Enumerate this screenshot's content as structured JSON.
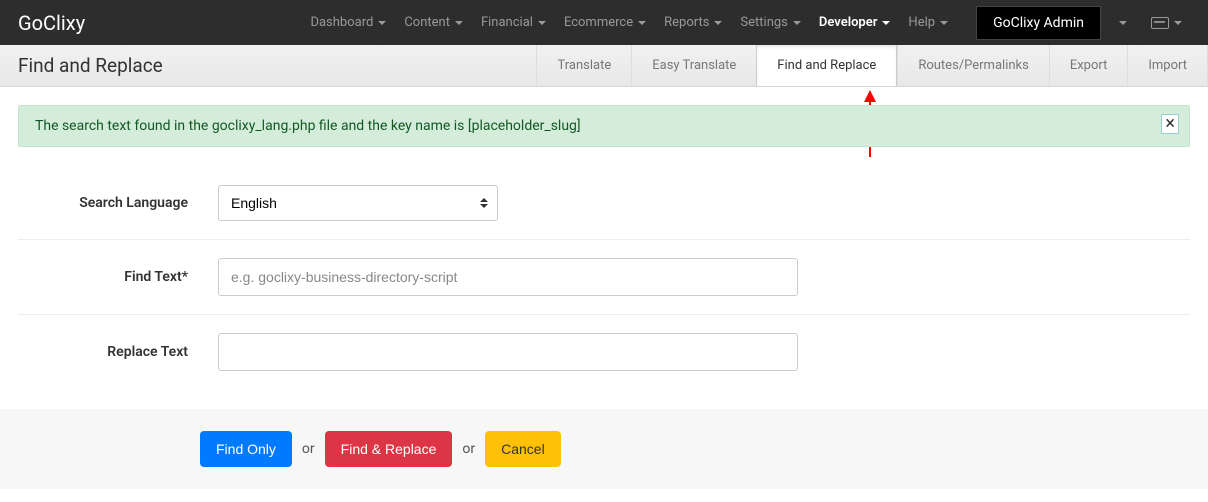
{
  "brand": "GoClixy",
  "nav": {
    "items": [
      {
        "label": "Dashboard"
      },
      {
        "label": "Content"
      },
      {
        "label": "Financial"
      },
      {
        "label": "Ecommerce"
      },
      {
        "label": "Reports"
      },
      {
        "label": "Settings"
      },
      {
        "label": "Developer",
        "active": true
      },
      {
        "label": "Help"
      }
    ],
    "admin_label": "GoClixy Admin"
  },
  "page_title": "Find and Replace",
  "tabs": [
    {
      "label": "Translate"
    },
    {
      "label": "Easy Translate"
    },
    {
      "label": "Find and Replace",
      "active": true
    },
    {
      "label": "Routes/Permalinks"
    },
    {
      "label": "Export"
    },
    {
      "label": "Import"
    }
  ],
  "alert": {
    "message": "The search text found in the goclixy_lang.php file and the key name is [placeholder_slug]",
    "close": "×"
  },
  "form": {
    "search_language": {
      "label": "Search Language",
      "value": "English"
    },
    "find_text": {
      "label": "Find Text*",
      "placeholder": "e.g. goclixy-business-directory-script",
      "value": ""
    },
    "replace_text": {
      "label": "Replace Text",
      "value": ""
    }
  },
  "actions": {
    "find_only": "Find Only",
    "or": "or",
    "find_replace": "Find & Replace",
    "cancel": "Cancel"
  }
}
